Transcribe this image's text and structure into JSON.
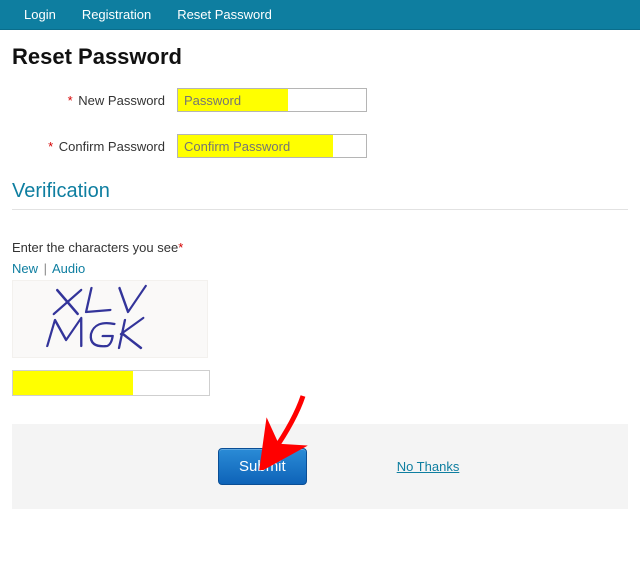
{
  "nav": {
    "login": "Login",
    "registration": "Registration",
    "reset_password": "Reset Password"
  },
  "title": "Reset Password",
  "fields": {
    "new_password": {
      "label": "New Password",
      "placeholder": "Password"
    },
    "confirm_password": {
      "label": "Confirm Password",
      "placeholder": "Confirm Password"
    }
  },
  "verification": {
    "heading": "Verification",
    "prompt": "Enter the characters you see",
    "req_marker": "*",
    "new_link": "New",
    "audio_link": "Audio",
    "divider": "|",
    "captcha_text": "XLV MGK"
  },
  "actions": {
    "submit": "Submit",
    "no_thanks": "No Thanks"
  },
  "colors": {
    "brand": "#0e7ea0",
    "highlight": "#ffff00",
    "required": "#d40000",
    "button_bg": "#1b73c6"
  }
}
